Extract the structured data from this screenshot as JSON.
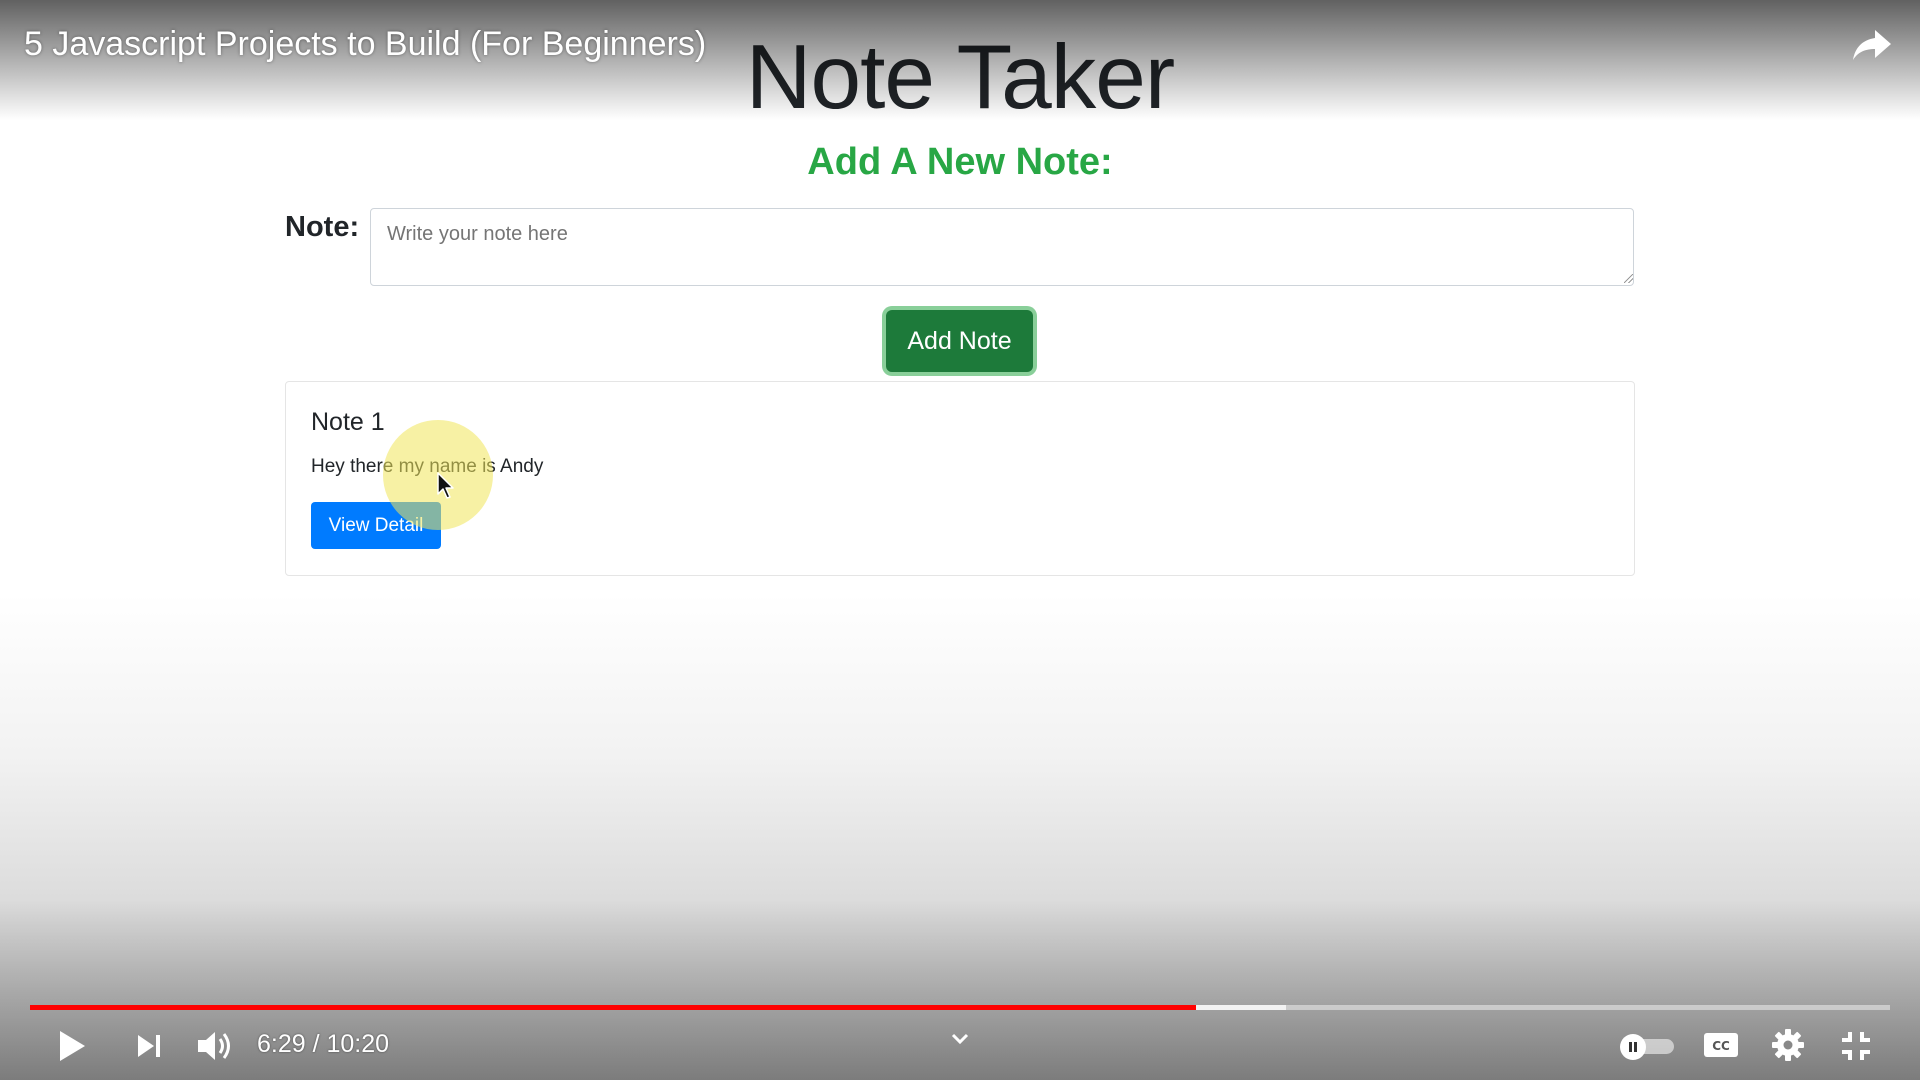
{
  "player": {
    "video_title": "5 Javascript Projects to Build (For Beginners)",
    "time_display": "6:29 / 10:20",
    "played_fraction": 0.627,
    "buffered_fraction": 0.675,
    "autoplay_on": false,
    "colors": {
      "progress": "#ff0000",
      "controls": "#ffffff"
    },
    "icons": [
      "share-icon",
      "play-icon",
      "next-icon",
      "volume-icon",
      "chevron-down-icon",
      "autoplay-toggle",
      "cc-icon",
      "gear-icon",
      "exit-fullscreen-icon"
    ]
  },
  "app": {
    "title": "Note Taker",
    "subheading": "Add A New Note:",
    "note_label": "Note:",
    "note_placeholder": "Write your note here",
    "add_button": "Add Note",
    "colors": {
      "heading_green": "#28a745",
      "add_button": "#1d7a3a",
      "detail_button": "#007bff"
    },
    "notes": [
      {
        "title": "Note 1",
        "text": "Hey there my name is Andy",
        "button": "View Detail"
      }
    ]
  }
}
